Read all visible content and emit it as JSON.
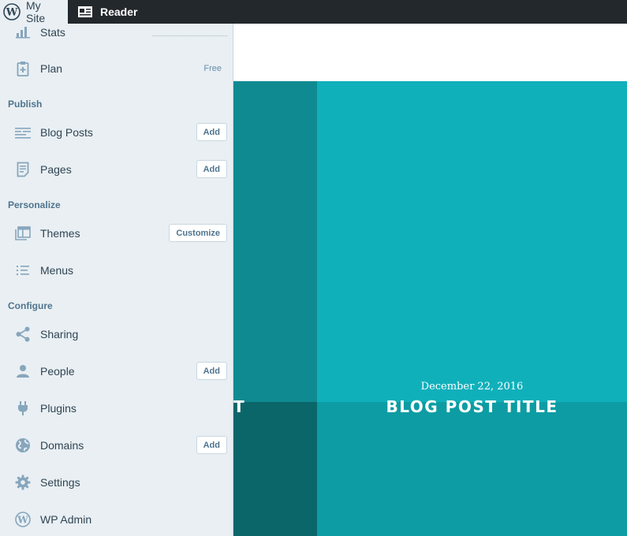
{
  "masterbar": {
    "my_site": "My Site",
    "reader": "Reader"
  },
  "sidebar": {
    "stats": "Stats",
    "plan": "Plan",
    "plan_badge": "Free",
    "publish_heading": "Publish",
    "blog_posts": "Blog Posts",
    "blog_posts_add": "Add",
    "pages": "Pages",
    "pages_add": "Add",
    "personalize_heading": "Personalize",
    "themes": "Themes",
    "themes_customize": "Customize",
    "menus": "Menus",
    "configure_heading": "Configure",
    "sharing": "Sharing",
    "people": "People",
    "people_add": "Add",
    "plugins": "Plugins",
    "domains": "Domains",
    "domains_add": "Add",
    "settings": "Settings",
    "wp_admin": "WP Admin"
  },
  "preview": {
    "post_date": "December 22, 2016",
    "post_title": "BLOG POST TITLE",
    "partial_title": "T"
  },
  "colors": {
    "masterbar": "#23282d",
    "sidebar": "#e9eff3",
    "tile_light": "#10b0bb",
    "tile_dark": "#0f8a91"
  }
}
